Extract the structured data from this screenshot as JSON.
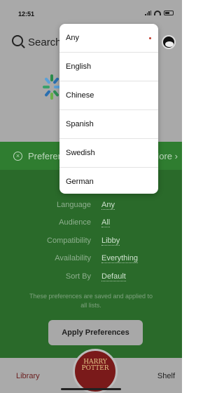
{
  "status_bar": {
    "time": "12:51"
  },
  "search": {
    "label": "Search"
  },
  "preferences_bar": {
    "title": "Preferences",
    "more": "More"
  },
  "preferences": {
    "rows": [
      {
        "label": "Language",
        "value": "Any"
      },
      {
        "label": "Audience",
        "value": "All"
      },
      {
        "label": "Compatibility",
        "value": "Libby"
      },
      {
        "label": "Availability",
        "value": "Everything"
      },
      {
        "label": "Sort By",
        "value": "Default"
      }
    ],
    "note": "These preferences are saved and applied to all lists.",
    "apply_label": "Apply Preferences"
  },
  "tabbar": {
    "library_label": "Library",
    "shelf_label": "Shelf",
    "book_title_line1": "HARRY",
    "book_title_line2": "POTTER"
  },
  "language_menu": {
    "selected": "Any",
    "items": [
      "Any",
      "English",
      "Chinese",
      "Spanish",
      "Swedish",
      "German"
    ]
  },
  "colors": {
    "green_panel": "#2a6a2a",
    "selected_dot": "#c0392b"
  }
}
